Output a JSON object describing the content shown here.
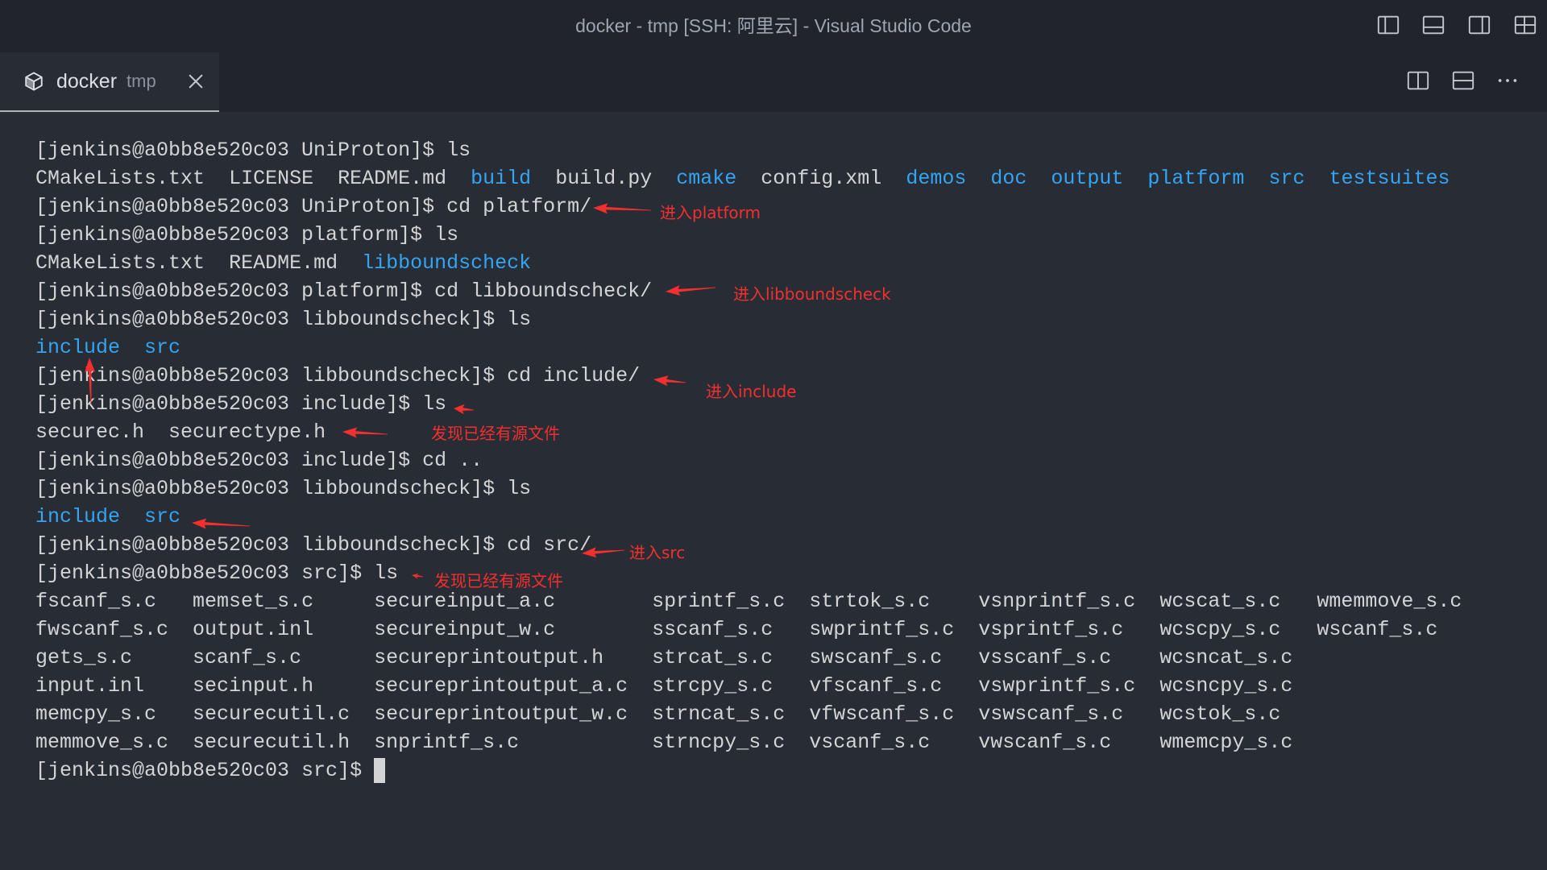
{
  "title_bar": {
    "title": "docker - tmp [SSH: 阿里云] - Visual Studio Code",
    "actions": [
      "toggle-primary-sidebar-icon",
      "toggle-panel-icon",
      "toggle-secondary-sidebar-icon",
      "customize-layout-icon"
    ]
  },
  "tab": {
    "icon": "package-icon",
    "label": "docker",
    "description": "tmp",
    "close_icon": "close-icon"
  },
  "tab_actions": [
    "split-editor-right-icon",
    "split-editor-down-icon",
    "more-actions-icon"
  ],
  "terminal": {
    "lines": [
      {
        "text": "[jenkins@a0bb8e520c03 UniProton]$ ls"
      },
      {
        "items": [
          {
            "name": "CMakeLists.txt"
          },
          {
            "name": "LICENSE"
          },
          {
            "name": "README.md"
          },
          {
            "name": "build",
            "dir": true
          },
          {
            "name": "build.py"
          },
          {
            "name": "cmake",
            "dir": true
          },
          {
            "name": "config.xml"
          },
          {
            "name": "demos",
            "dir": true
          },
          {
            "name": "doc",
            "dir": true
          },
          {
            "name": "output",
            "dir": true
          },
          {
            "name": "platform",
            "dir": true
          },
          {
            "name": "src",
            "dir": true
          },
          {
            "name": "testsuites",
            "dir": true
          }
        ]
      },
      {
        "text": "[jenkins@a0bb8e520c03 UniProton]$ cd platform/"
      },
      {
        "text": "[jenkins@a0bb8e520c03 platform]$ ls"
      },
      {
        "items": [
          {
            "name": "CMakeLists.txt"
          },
          {
            "name": "README.md"
          },
          {
            "name": "libboundscheck",
            "dir": true
          }
        ]
      },
      {
        "text": "[jenkins@a0bb8e520c03 platform]$ cd libboundscheck/"
      },
      {
        "text": "[jenkins@a0bb8e520c03 libboundscheck]$ ls"
      },
      {
        "items": [
          {
            "name": "include",
            "dir": true
          },
          {
            "name": "src",
            "dir": true
          }
        ]
      },
      {
        "text": "[jenkins@a0bb8e520c03 libboundscheck]$ cd include/"
      },
      {
        "text": "[jenkins@a0bb8e520c03 include]$ ls"
      },
      {
        "items": [
          {
            "name": "securec.h"
          },
          {
            "name": "securectype.h"
          }
        ]
      },
      {
        "text": "[jenkins@a0bb8e520c03 include]$ cd .."
      },
      {
        "text": "[jenkins@a0bb8e520c03 libboundscheck]$ ls"
      },
      {
        "items": [
          {
            "name": "include",
            "dir": true
          },
          {
            "name": "src",
            "dir": true
          }
        ]
      },
      {
        "text": "[jenkins@a0bb8e520c03 libboundscheck]$ cd src/"
      },
      {
        "text": "[jenkins@a0bb8e520c03 src]$ ls"
      },
      {
        "rows": [
          [
            "fscanf_s.c",
            "memset_s.c",
            "secureinput_a.c",
            "sprintf_s.c",
            "strtok_s.c",
            "vsnprintf_s.c",
            "wcscat_s.c",
            "wmemmove_s.c"
          ],
          [
            "fwscanf_s.c",
            "output.inl",
            "secureinput_w.c",
            "sscanf_s.c",
            "swprintf_s.c",
            "vsprintf_s.c",
            "wcscpy_s.c",
            "wscanf_s.c"
          ],
          [
            "gets_s.c",
            "scanf_s.c",
            "secureprintoutput.h",
            "strcat_s.c",
            "swscanf_s.c",
            "vsscanf_s.c",
            "wcsncat_s.c"
          ],
          [
            "input.inl",
            "secinput.h",
            "secureprintoutput_a.c",
            "strcpy_s.c",
            "vfscanf_s.c",
            "vswprintf_s.c",
            "wcsncpy_s.c"
          ],
          [
            "memcpy_s.c",
            "securecutil.c",
            "secureprintoutput_w.c",
            "strncat_s.c",
            "vfwscanf_s.c",
            "vswscanf_s.c",
            "wcstok_s.c"
          ],
          [
            "memmove_s.c",
            "securecutil.h",
            "snprintf_s.c",
            "strncpy_s.c",
            "vscanf_s.c",
            "vwscanf_s.c",
            "wmemcpy_s.c"
          ]
        ]
      },
      {
        "text": "[jenkins@a0bb8e520c03 src]$",
        "cursor": true
      }
    ]
  },
  "annotations": [
    "进入platform",
    "进入libboundscheck",
    "进入include",
    "发现已经有源文件",
    "进入src",
    "发现已经有源文件"
  ],
  "colors": {
    "directory": "#33a5f3",
    "annotation": "#f42f2f"
  }
}
